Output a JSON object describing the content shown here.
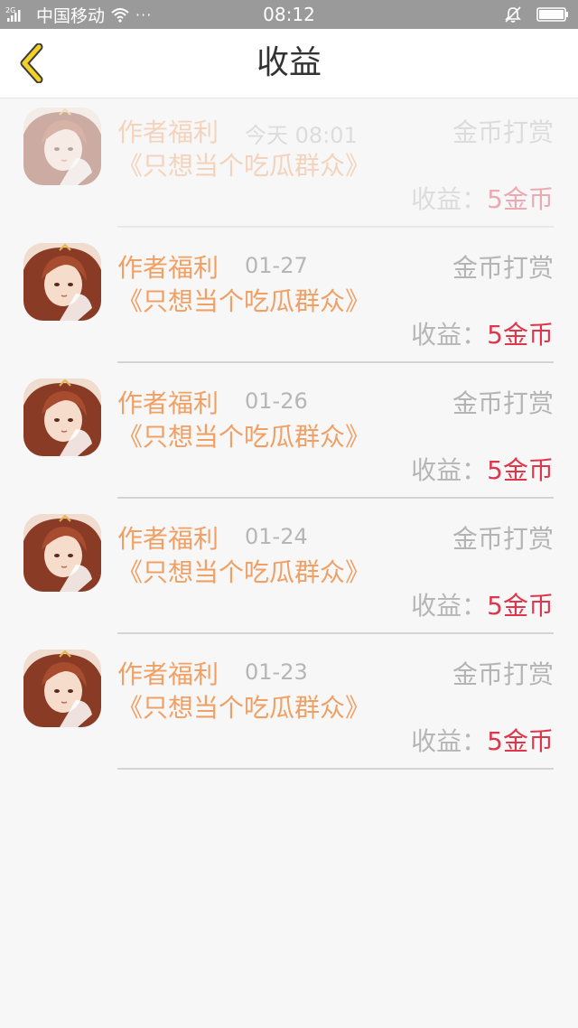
{
  "status_bar": {
    "network": "2G",
    "carrier": "中国移动",
    "dots": "···",
    "time": "08:12",
    "icons": [
      "signal-icon",
      "wifi-icon",
      "mute-icon",
      "battery-icon"
    ],
    "battery_level": 1.0
  },
  "header": {
    "title": "收益",
    "back_icon": "chevron-left-icon",
    "back_color": "#f2d226"
  },
  "earnings": [
    {
      "type": "作者福利",
      "date": "今天 08:01",
      "category": "金币打赏",
      "book": "《只想当个吃瓜群众》",
      "earning_label": "收益：",
      "earning_value": "5金币",
      "faded": true
    },
    {
      "type": "作者福利",
      "date": "01-27",
      "category": "金币打赏",
      "book": "《只想当个吃瓜群众》",
      "earning_label": "收益：",
      "earning_value": "5金币",
      "faded": false
    },
    {
      "type": "作者福利",
      "date": "01-26",
      "category": "金币打赏",
      "book": "《只想当个吃瓜群众》",
      "earning_label": "收益：",
      "earning_value": "5金币",
      "faded": false
    },
    {
      "type": "作者福利",
      "date": "01-24",
      "category": "金币打赏",
      "book": "《只想当个吃瓜群众》",
      "earning_label": "收益：",
      "earning_value": "5金币",
      "faded": false
    },
    {
      "type": "作者福利",
      "date": "01-23",
      "category": "金币打赏",
      "book": "《只想当个吃瓜群众》",
      "earning_label": "收益：",
      "earning_value": "5金币",
      "faded": false
    }
  ],
  "colors": {
    "accent": "#f0a065",
    "earning": "#e0364b",
    "muted": "#b4b4b4",
    "status_bar": "#9a9a9a"
  }
}
